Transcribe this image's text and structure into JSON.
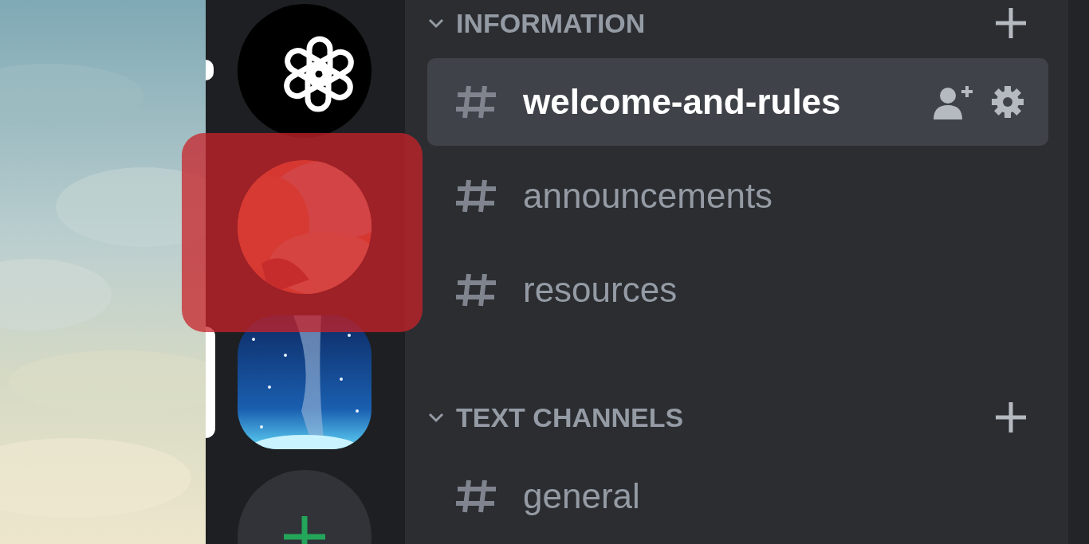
{
  "servers": [
    {
      "kind": "logo",
      "unread": true,
      "selected": false
    },
    {
      "kind": "picture",
      "unread": false,
      "selected": false
    },
    {
      "kind": "picture",
      "unread": false,
      "selected": true
    },
    {
      "kind": "add",
      "unread": false,
      "selected": false
    }
  ],
  "categories": [
    {
      "name": "INFORMATION",
      "expanded": true,
      "channels": [
        {
          "name": "welcome-and-rules",
          "selected": true
        },
        {
          "name": "announcements",
          "selected": false
        },
        {
          "name": "resources",
          "selected": false
        }
      ]
    },
    {
      "name": "TEXT CHANNELS",
      "expanded": true,
      "channels": [
        {
          "name": "general",
          "selected": false
        }
      ]
    }
  ]
}
